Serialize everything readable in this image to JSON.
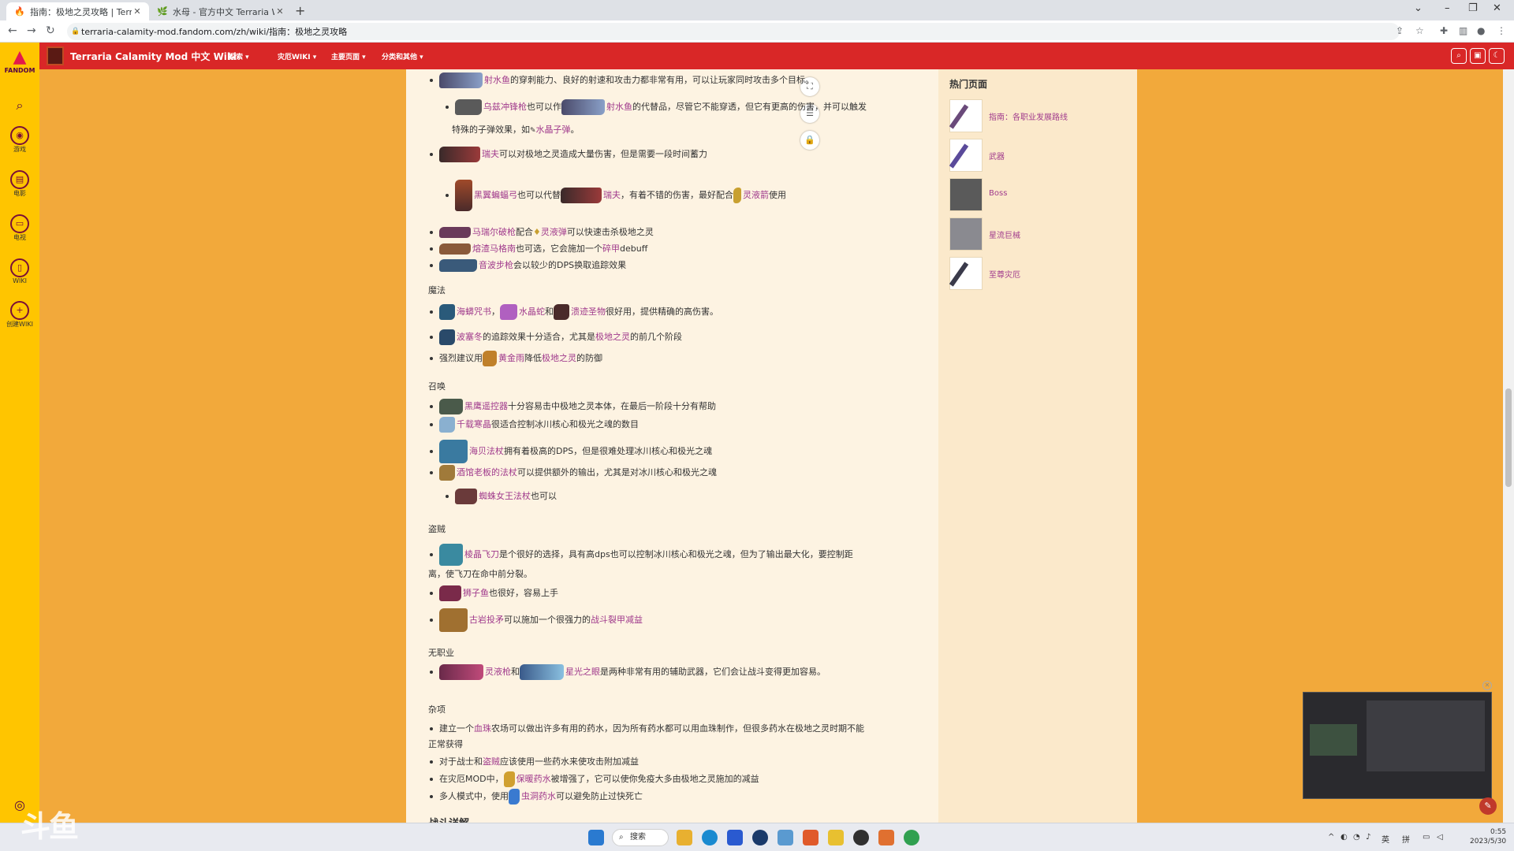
{
  "browser": {
    "tabs": [
      {
        "title": "指南：极地之灵攻略 | Terraria C",
        "active": true
      },
      {
        "title": "水母 - 官方中文 Terraria Wiki",
        "active": false
      }
    ],
    "url": "terraria-calamity-mod.fandom.com/zh/wiki/指南：极地之灵攻略"
  },
  "rail": {
    "logo_label": "FANDOM",
    "items": [
      {
        "label": "游戏",
        "icon": "controller-icon"
      },
      {
        "label": "电影",
        "icon": "film-icon"
      },
      {
        "label": "电视",
        "icon": "tv-icon"
      },
      {
        "label": "WIKI",
        "icon": "book-icon"
      },
      {
        "label": "创建WIKI",
        "icon": "plus-icon"
      }
    ]
  },
  "wiki": {
    "title": "Terraria Calamity Mod 中文 Wiki",
    "nav": [
      "探索",
      "灾厄WIKI",
      "主要页面",
      "分类和其他"
    ]
  },
  "content": {
    "lines": [
      {
        "pre": "",
        "link": "射水鱼",
        "rest": "的穿刺能力、良好的射速和攻击力都非常有用，可以让玩家同时攻击多个目标。"
      },
      {
        "pre": "",
        "link": "乌兹冲锋枪",
        "mid": "也可以作",
        "link2": "射水鱼",
        "rest": "的代替品，尽管它不能穿透，但它有更高的伤害，并可以触发"
      },
      {
        "cont": "特殊的子弹效果，如",
        "link": "水晶子弹",
        "rest": "。"
      },
      {
        "link": "瑞夫",
        "rest": "可以对极地之灵造成大量伤害，但是需要一段时间蓄力"
      },
      {
        "link": "黑翼蝙蝠弓",
        "mid": "也可以代替",
        "link2": "瑞夫",
        "rest": "，有着不错的伤害，最好配合",
        "link3": "灵液箭",
        "rest2": "使用"
      },
      {
        "link": "马瑞尔破枪",
        "mid": "配合",
        "link2": "灵液弹",
        "rest": "可以快速击杀极地之灵"
      },
      {
        "link": "熔渣马格南",
        "mid": "也可选，它会施加一个",
        "link2": "碎甲",
        "rest": "debuff"
      },
      {
        "link": "音波步枪",
        "rest": "会以较少的DPS换取追踪效果"
      },
      {
        "heading": "魔法"
      },
      {
        "link": "海蟒咒书",
        "mid": "，",
        "link2": "水晶蛇",
        "mid2": "和",
        "link3": "溃迹圣物",
        "rest": "很好用，提供精确的高伤害。"
      },
      {
        "link": "波塞冬",
        "mid": "的追踪效果十分适合，尤其是",
        "link2": "极地之灵",
        "rest": "的前几个阶段"
      },
      {
        "pre": "强烈建议用",
        "link": "黄金雨",
        "mid": "降低",
        "link2": "极地之灵",
        "rest": "的防御"
      },
      {
        "heading": "召唤"
      },
      {
        "link": "黑鹰遥控器",
        "rest": "十分容易击中极地之灵本体，在最后一阶段十分有帮助"
      },
      {
        "link": "千载寒晶",
        "rest": "很适合控制冰川核心和极光之魂的数目"
      },
      {
        "link": "海贝法杖",
        "rest": "拥有着极高的DPS，但是很难处理冰川核心和极光之魂"
      },
      {
        "link": "酒馆老板的法杖",
        "rest": "可以提供额外的输出，尤其是对冰川核心和极光之魂"
      },
      {
        "link": "蜘蛛女王法杖",
        "rest": "也可以"
      },
      {
        "heading": "盗贼"
      },
      {
        "link": "棱晶飞刀",
        "rest": "是个很好的选择，具有高dps也可以控制冰川核心和极光之魂，但为了输出最大化，要控制距"
      },
      {
        "cont": "离，使飞刀在命中前分裂。"
      },
      {
        "link": "狮子鱼",
        "rest": "也很好，容易上手"
      },
      {
        "link": "古岩投矛",
        "mid": "可以施加一个很强力的",
        "link2": "战斗裂甲减益",
        "rest": ""
      },
      {
        "heading": "无职业"
      },
      {
        "link": "灵液枪",
        "mid": "和",
        "link2": "星光之眼",
        "rest": "是两种非常有用的辅助武器，它们会让战斗变得更加容易。"
      },
      {
        "heading": "杂项"
      },
      {
        "pre": "建立一个",
        "link": "血珠",
        "rest": "农场可以做出许多有用的药水，因为所有药水都可以用血珠制作，但很多药水在极地之灵时期不能"
      },
      {
        "cont": "正常获得"
      },
      {
        "pre": "对于战士和",
        "link": "盗贼",
        "rest": "应该使用一些药水来使攻击附加减益"
      },
      {
        "pre": "在灾厄MOD中，",
        "link": "保暖药水",
        "rest": "被增强了，它可以使你免疫大多由极地之灵施加的减益"
      },
      {
        "pre": "多人模式中，使用",
        "link": "虫洞药水",
        "rest": "可以避免防止过快死亡"
      },
      {
        "partial": "战斗详解"
      }
    ]
  },
  "right_rail": {
    "title": "热门页面",
    "items": [
      "指南：各职业发展路线",
      "武器",
      "Boss",
      "星流巨械",
      "至尊灾厄"
    ]
  },
  "taskbar": {
    "search": "搜索",
    "ime1": "英",
    "ime2": "拼",
    "time": "0:55",
    "date": "2023/5/30"
  },
  "overlay": {
    "watermark": "斗鱼"
  },
  "colors": {
    "header_red": "#d92727",
    "rail_yellow": "#ffc500",
    "page_bg": "#fdf3e2",
    "link": "#a03a8c",
    "outer_bg": "#f2a93b"
  }
}
